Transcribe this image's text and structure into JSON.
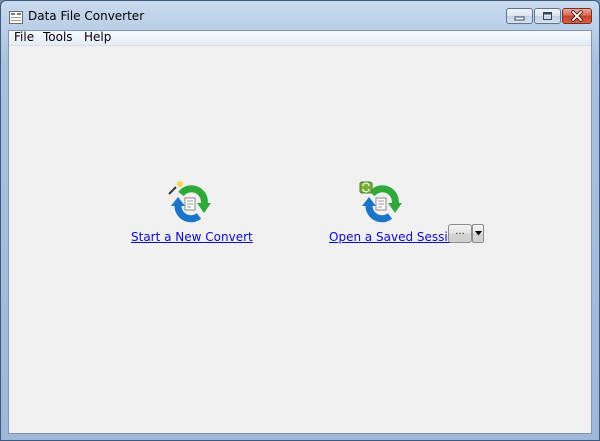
{
  "window": {
    "title": "Data File Converter",
    "app_icon": "converter-app-icon",
    "controls": [
      "minimize-icon",
      "maximize-icon",
      "close-icon"
    ]
  },
  "menu": {
    "items": [
      {
        "label": "File"
      },
      {
        "label": "Tools"
      },
      {
        "label": "Help"
      }
    ]
  },
  "actions": {
    "new_convert": {
      "label": "Start a New Convert",
      "icon": "new-convert-icon"
    },
    "open_session": {
      "label": "Open a Saved Session",
      "icon": "saved-session-icon",
      "browse_label": "...",
      "dropdown_icon": "dropdown-arrow-icon"
    }
  },
  "colors": {
    "link": "#0b0bc8",
    "icon_green": "#2faa3a",
    "icon_blue": "#1a74c8",
    "window_frame": "#aac1de",
    "client_bg": "#f0f0f0",
    "close_button": "#c4412a"
  }
}
